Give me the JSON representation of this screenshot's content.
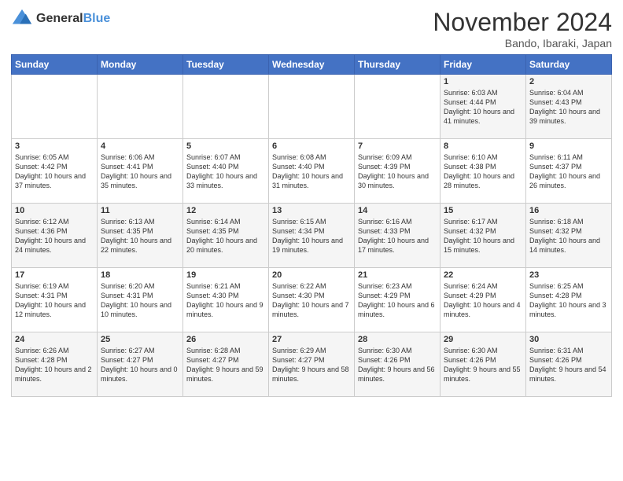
{
  "logo": {
    "line1": "General",
    "line2": "Blue"
  },
  "title": "November 2024",
  "location": "Bando, Ibaraki, Japan",
  "days_of_week": [
    "Sunday",
    "Monday",
    "Tuesday",
    "Wednesday",
    "Thursday",
    "Friday",
    "Saturday"
  ],
  "weeks": [
    [
      {
        "day": "",
        "info": ""
      },
      {
        "day": "",
        "info": ""
      },
      {
        "day": "",
        "info": ""
      },
      {
        "day": "",
        "info": ""
      },
      {
        "day": "",
        "info": ""
      },
      {
        "day": "1",
        "info": "Sunrise: 6:03 AM\nSunset: 4:44 PM\nDaylight: 10 hours and 41 minutes."
      },
      {
        "day": "2",
        "info": "Sunrise: 6:04 AM\nSunset: 4:43 PM\nDaylight: 10 hours and 39 minutes."
      }
    ],
    [
      {
        "day": "3",
        "info": "Sunrise: 6:05 AM\nSunset: 4:42 PM\nDaylight: 10 hours and 37 minutes."
      },
      {
        "day": "4",
        "info": "Sunrise: 6:06 AM\nSunset: 4:41 PM\nDaylight: 10 hours and 35 minutes."
      },
      {
        "day": "5",
        "info": "Sunrise: 6:07 AM\nSunset: 4:40 PM\nDaylight: 10 hours and 33 minutes."
      },
      {
        "day": "6",
        "info": "Sunrise: 6:08 AM\nSunset: 4:40 PM\nDaylight: 10 hours and 31 minutes."
      },
      {
        "day": "7",
        "info": "Sunrise: 6:09 AM\nSunset: 4:39 PM\nDaylight: 10 hours and 30 minutes."
      },
      {
        "day": "8",
        "info": "Sunrise: 6:10 AM\nSunset: 4:38 PM\nDaylight: 10 hours and 28 minutes."
      },
      {
        "day": "9",
        "info": "Sunrise: 6:11 AM\nSunset: 4:37 PM\nDaylight: 10 hours and 26 minutes."
      }
    ],
    [
      {
        "day": "10",
        "info": "Sunrise: 6:12 AM\nSunset: 4:36 PM\nDaylight: 10 hours and 24 minutes."
      },
      {
        "day": "11",
        "info": "Sunrise: 6:13 AM\nSunset: 4:35 PM\nDaylight: 10 hours and 22 minutes."
      },
      {
        "day": "12",
        "info": "Sunrise: 6:14 AM\nSunset: 4:35 PM\nDaylight: 10 hours and 20 minutes."
      },
      {
        "day": "13",
        "info": "Sunrise: 6:15 AM\nSunset: 4:34 PM\nDaylight: 10 hours and 19 minutes."
      },
      {
        "day": "14",
        "info": "Sunrise: 6:16 AM\nSunset: 4:33 PM\nDaylight: 10 hours and 17 minutes."
      },
      {
        "day": "15",
        "info": "Sunrise: 6:17 AM\nSunset: 4:32 PM\nDaylight: 10 hours and 15 minutes."
      },
      {
        "day": "16",
        "info": "Sunrise: 6:18 AM\nSunset: 4:32 PM\nDaylight: 10 hours and 14 minutes."
      }
    ],
    [
      {
        "day": "17",
        "info": "Sunrise: 6:19 AM\nSunset: 4:31 PM\nDaylight: 10 hours and 12 minutes."
      },
      {
        "day": "18",
        "info": "Sunrise: 6:20 AM\nSunset: 4:31 PM\nDaylight: 10 hours and 10 minutes."
      },
      {
        "day": "19",
        "info": "Sunrise: 6:21 AM\nSunset: 4:30 PM\nDaylight: 10 hours and 9 minutes."
      },
      {
        "day": "20",
        "info": "Sunrise: 6:22 AM\nSunset: 4:30 PM\nDaylight: 10 hours and 7 minutes."
      },
      {
        "day": "21",
        "info": "Sunrise: 6:23 AM\nSunset: 4:29 PM\nDaylight: 10 hours and 6 minutes."
      },
      {
        "day": "22",
        "info": "Sunrise: 6:24 AM\nSunset: 4:29 PM\nDaylight: 10 hours and 4 minutes."
      },
      {
        "day": "23",
        "info": "Sunrise: 6:25 AM\nSunset: 4:28 PM\nDaylight: 10 hours and 3 minutes."
      }
    ],
    [
      {
        "day": "24",
        "info": "Sunrise: 6:26 AM\nSunset: 4:28 PM\nDaylight: 10 hours and 2 minutes."
      },
      {
        "day": "25",
        "info": "Sunrise: 6:27 AM\nSunset: 4:27 PM\nDaylight: 10 hours and 0 minutes."
      },
      {
        "day": "26",
        "info": "Sunrise: 6:28 AM\nSunset: 4:27 PM\nDaylight: 9 hours and 59 minutes."
      },
      {
        "day": "27",
        "info": "Sunrise: 6:29 AM\nSunset: 4:27 PM\nDaylight: 9 hours and 58 minutes."
      },
      {
        "day": "28",
        "info": "Sunrise: 6:30 AM\nSunset: 4:26 PM\nDaylight: 9 hours and 56 minutes."
      },
      {
        "day": "29",
        "info": "Sunrise: 6:30 AM\nSunset: 4:26 PM\nDaylight: 9 hours and 55 minutes."
      },
      {
        "day": "30",
        "info": "Sunrise: 6:31 AM\nSunset: 4:26 PM\nDaylight: 9 hours and 54 minutes."
      }
    ]
  ]
}
